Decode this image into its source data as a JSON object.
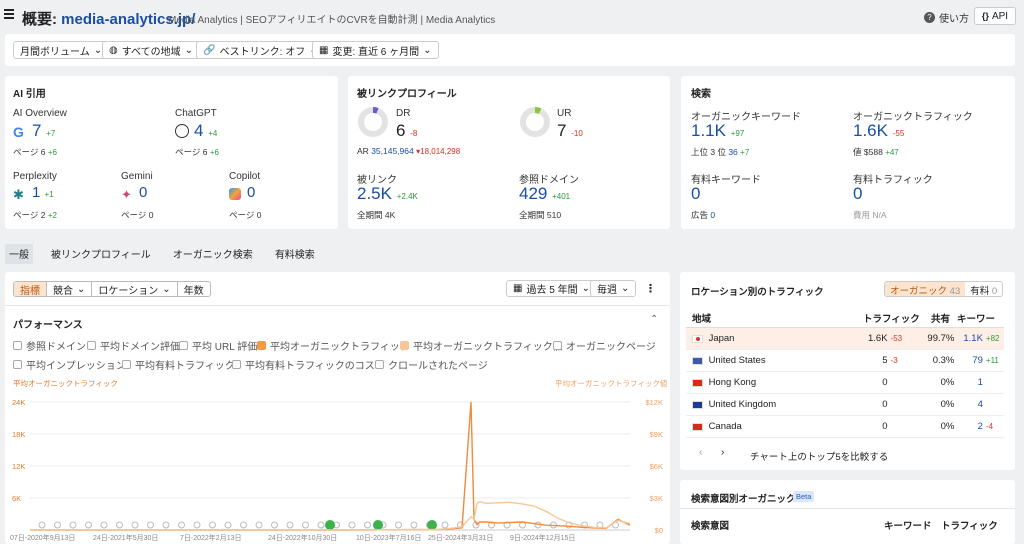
{
  "header": {
    "title_prefix": "概要: ",
    "domain": "media-analytics.jp/",
    "subtitle": "Media Analytics | SEOアフィリエイトのCVRを自動計測 | Media Analytics",
    "help": "使い方",
    "api": "API"
  },
  "filters": [
    "月間ボリューム",
    "すべての地域",
    "ベストリンク: オフ",
    "変更: 直近 6 ヶ月間"
  ],
  "ai": {
    "title": "AI 引用",
    "items": [
      {
        "name": "AI Overview",
        "value": "7",
        "delta": "+7",
        "pages_label": "ページ",
        "pages": "6",
        "pages_delta": "+6"
      },
      {
        "name": "ChatGPT",
        "value": "4",
        "delta": "+4",
        "pages_label": "ページ",
        "pages": "6",
        "pages_delta": "+6"
      },
      {
        "name": "Perplexity",
        "value": "1",
        "delta": "+1",
        "pages_label": "ページ",
        "pages": "2",
        "pages_delta": "+2"
      },
      {
        "name": "Gemini",
        "value": "0",
        "delta": "",
        "pages_label": "ページ",
        "pages": "0",
        "pages_delta": ""
      },
      {
        "name": "Copilot",
        "value": "0",
        "delta": "",
        "pages_label": "ページ",
        "pages": "0",
        "pages_delta": ""
      }
    ]
  },
  "backlinks": {
    "title": "被リンクプロフィール",
    "dr_label": "DR",
    "dr": "6",
    "dr_delta": "-8",
    "ur_label": "UR",
    "ur": "7",
    "ur_delta": "-10",
    "ar_label": "AR",
    "ar": "35,145,964",
    "ar_delta": "▾18,014,298",
    "links_label": "被リンク",
    "links": "2.5K",
    "links_delta": "+2.4K",
    "links_all_label": "全期間",
    "links_all": "4K",
    "rd_label": "参照ドメイン",
    "rd": "429",
    "rd_delta": "+401",
    "rd_all_label": "全期間",
    "rd_all": "510",
    "dr_ratio": 0.06,
    "ur_ratio": 0.07
  },
  "search": {
    "title": "検索",
    "ok_label": "オーガニックキーワード",
    "ok": "1.1K",
    "ok_delta": "+97",
    "top3_label": "上位 3 位",
    "top3": "36",
    "top3_delta": "+7",
    "ot_label": "オーガニックトラフィック",
    "ot": "1.6K",
    "ot_delta": "-55",
    "value_label": "値",
    "value": "$588",
    "value_delta": "+47",
    "pk_label": "有料キーワード",
    "pk": "0",
    "ads_label": "広告",
    "ads": "0",
    "pt_label": "有料トラフィック",
    "pt": "0",
    "cost_label": "費用",
    "cost": "N/A"
  },
  "tabs": [
    "一般",
    "被リンクプロフィール",
    "オーガニック検索",
    "有料検索"
  ],
  "toolbar": {
    "seg": [
      "指標",
      "競合",
      "ロケーション",
      "年数"
    ],
    "range": "過去 5 年間",
    "interval": "毎週",
    "more": "⋮"
  },
  "perf": {
    "title": "パフォーマンス",
    "checks": [
      {
        "label": "参照ドメイン",
        "state": ""
      },
      {
        "label": "平均ドメイン評価",
        "state": ""
      },
      {
        "label": "平均 URL 評価",
        "state": ""
      },
      {
        "label": "平均オーガニックトラフィック",
        "state": "chk"
      },
      {
        "label": "平均オーガニックトラフィック値",
        "state": "chk2"
      },
      {
        "label": "オーガニックページ",
        "state": ""
      },
      {
        "label": "平均インプレッション",
        "state": ""
      },
      {
        "label": "平均有料トラフィック",
        "state": ""
      },
      {
        "label": "平均有料トラフィックのコスト",
        "state": ""
      },
      {
        "label": "クロールされたページ",
        "state": ""
      }
    ]
  },
  "chart_data": {
    "type": "line",
    "left_axis_label": "平均オーガニックトラフィック",
    "right_axis_label": "平均オーガニックトラフィック値",
    "left_ticks": [
      "24K",
      "18K",
      "12K",
      "6K"
    ],
    "right_ticks": [
      "$12K",
      "$9K",
      "$6K",
      "$3K",
      "$0"
    ],
    "x_ticks": [
      "07日-2020年9月13日",
      "24日-2021年5月30日",
      "7日-2022年2月13日",
      "24日-2022年10月30日",
      "10日-2023年7月16日",
      "25日-2024年3月31日",
      "9日-2024年12月15日"
    ],
    "ylim": [
      0,
      24000
    ],
    "x": [
      0,
      0.55,
      0.6,
      0.68,
      0.7,
      0.72,
      0.735,
      0.74,
      0.745,
      0.75,
      0.76,
      0.78,
      0.8,
      0.82,
      0.84,
      0.86,
      0.88,
      0.9,
      0.92,
      0.94,
      0.96,
      0.98,
      1.0
    ],
    "series": [
      {
        "name": "平均オーガニックトラフィック",
        "values": [
          0,
          0,
          50,
          100,
          200,
          400,
          24000,
          2000,
          1000,
          1500,
          1500,
          1300,
          1400,
          1500,
          1200,
          900,
          800,
          700,
          500,
          400,
          300,
          2000,
          900
        ]
      },
      {
        "name": "平均オーガニックトラフィック値",
        "values": [
          0,
          0,
          50,
          100,
          300,
          600,
          2500,
          2000,
          5000,
          5300,
          5000,
          5100,
          5200,
          4900,
          4500,
          3500,
          2200,
          1300,
          800,
          500,
          400,
          1800,
          1200
        ]
      }
    ],
    "markers": [
      {
        "x": 0.5,
        "label": "5"
      },
      {
        "x": 0.58,
        "label": ""
      },
      {
        "x": 0.67,
        "label": ""
      }
    ]
  },
  "location": {
    "title": "ロケーション別のトラフィック",
    "tab_org": "オーガニック",
    "tab_org_count": "43",
    "tab_paid": "有料",
    "tab_paid_count": "0",
    "cols": [
      "地域",
      "トラフィック",
      "共有",
      "キーワード"
    ],
    "rows": [
      {
        "name": "Japan",
        "traffic": "1.6K",
        "td": "-53",
        "share": "99.7%",
        "kw": "1.1K",
        "kd": "+82",
        "color": "#d93025"
      },
      {
        "name": "United States",
        "traffic": "5",
        "td": "-3",
        "share": "0.3%",
        "kw": "79",
        "kd": "+11",
        "color": "#3c5aa6"
      },
      {
        "name": "Hong Kong",
        "traffic": "0",
        "td": "",
        "share": "0%",
        "kw": "1",
        "kd": "",
        "color": "#de2910"
      },
      {
        "name": "United Kingdom",
        "traffic": "0",
        "td": "",
        "share": "0%",
        "kw": "4",
        "kd": "",
        "color": "#1f3a93"
      },
      {
        "name": "Canada",
        "traffic": "0",
        "td": "",
        "share": "0%",
        "kw": "2",
        "kd": "-4",
        "color": "#d52b1e"
      }
    ],
    "compare": "チャート上のトップ5を比較する"
  },
  "intent": {
    "title": "検索意図別オーガニック",
    "beta": "Beta",
    "cols": [
      "検索意図",
      "キーワード",
      "トラフィック"
    ]
  }
}
